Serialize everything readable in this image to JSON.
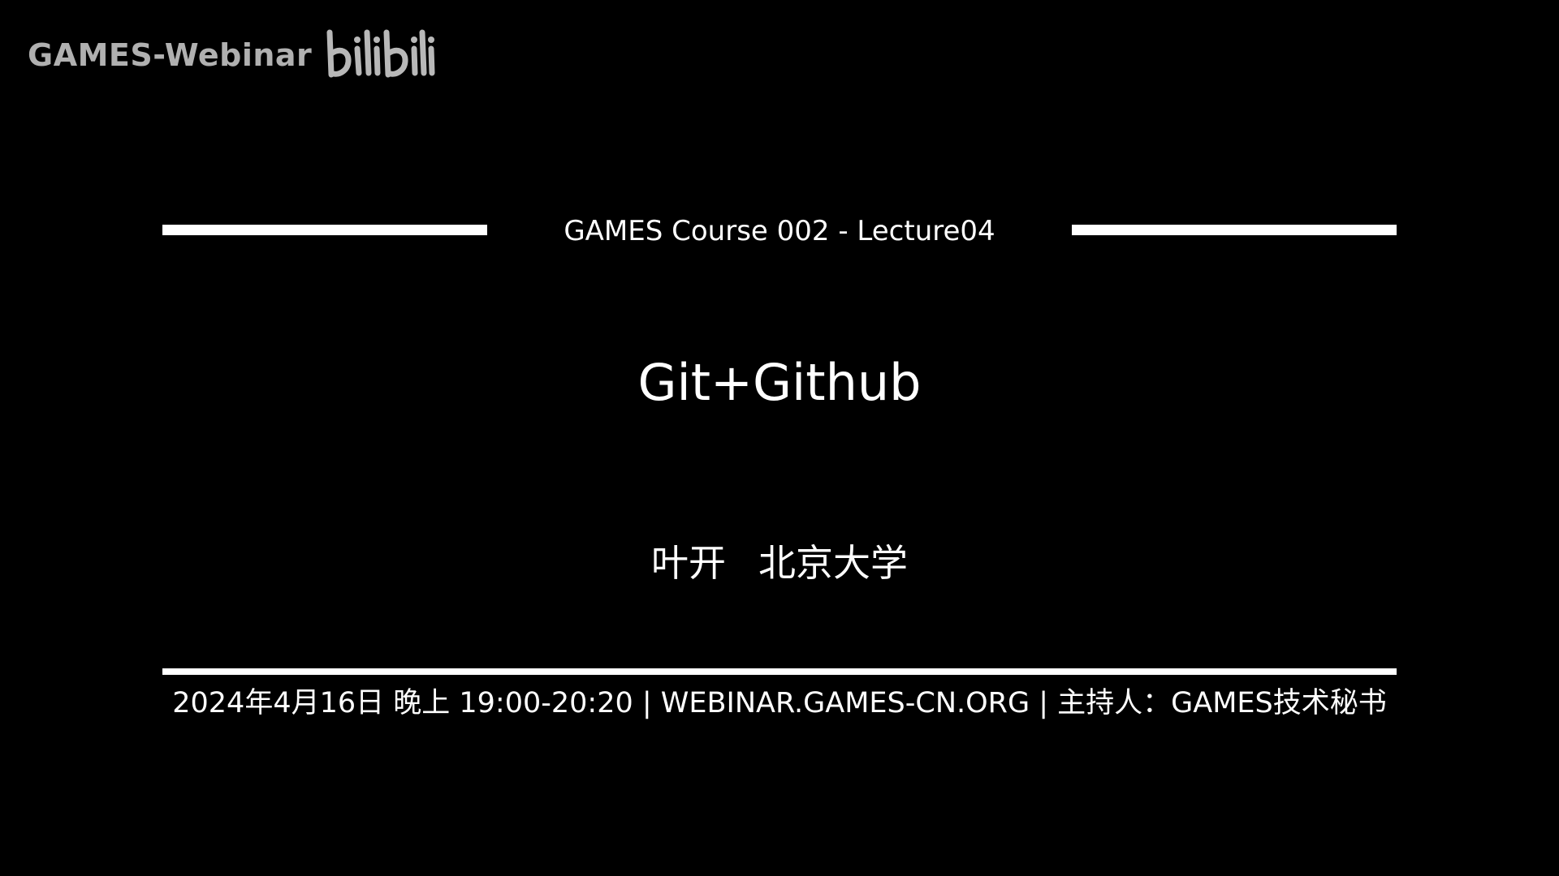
{
  "watermark": {
    "channel": "GAMES-Webinar",
    "logo_wordmark": "bilibili",
    "logo_icon": "bilibili-logo-icon",
    "color": "#bfbfbf"
  },
  "slide": {
    "background": "#000000",
    "text_color": "#ffffff",
    "course_title": "GAMES Course 002 - Lecture04",
    "lecture_title": "Git+Github",
    "speaker": "叶开",
    "affiliation": "北京大学",
    "info": "2024年4月16日 晚上 19:00-20:20 | WEBINAR.GAMES-CN.ORG | 主持人：GAMES技术秘书"
  }
}
